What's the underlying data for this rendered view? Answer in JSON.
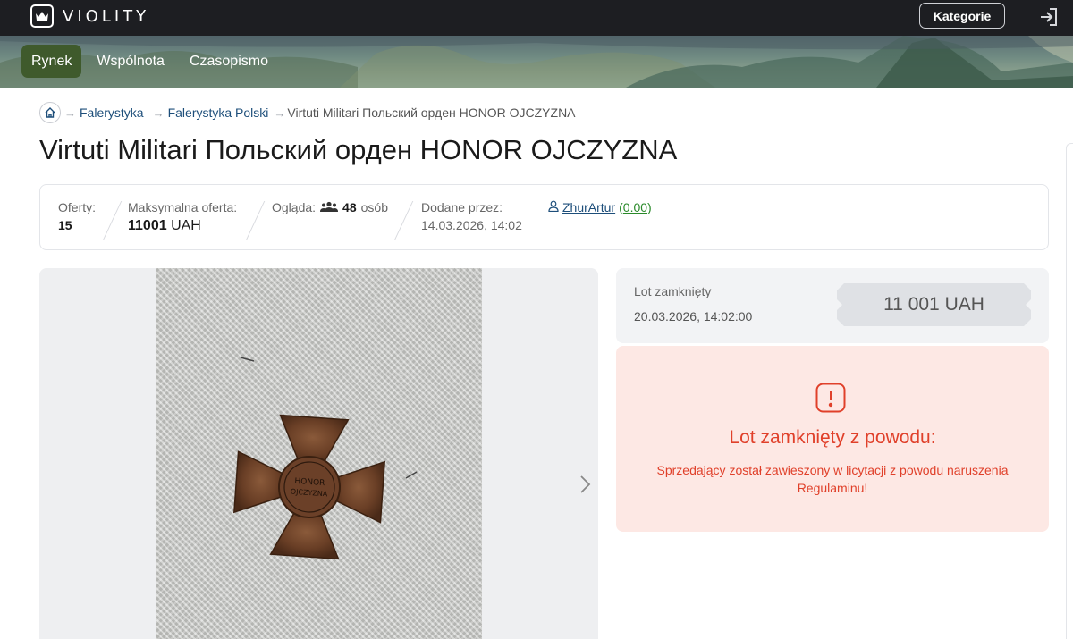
{
  "header": {
    "brand": "VIOLITY",
    "categories_label": "Kategorie"
  },
  "nav": {
    "items": [
      "Rynek",
      "Wspólnota",
      "Czasopismo"
    ],
    "active": "Rynek"
  },
  "breadcrumb": {
    "items": [
      "Falerystyka",
      "Falerystyka Polski",
      "Virtuti Militari Польский орден HONOR OJCZYZNA"
    ],
    "separator": "→"
  },
  "lot": {
    "title": "Virtuti Militari Польский орден HONOR OJCZYZNA",
    "offers_label": "Oferty:",
    "offers_value": "15",
    "max_offer_label": "Maksymalna oferta:",
    "max_offer_amount": "11001",
    "max_offer_currency": "UAH",
    "watching_label": "Ogląda:",
    "watching_count": "48",
    "watching_unit": "osób",
    "added_by_label": "Dodane przez:",
    "added_date": "14.03.2026, 14:02",
    "seller_name": "ZhurArtur",
    "seller_rating": "0.00"
  },
  "status": {
    "closed_label": "Lot zamknięty",
    "closed_date": "20.03.2026, 14:02:00",
    "final_price": "11 001 UAH"
  },
  "alert": {
    "title": "Lot zamknięty z powodu:",
    "message": "Sprzedający został zawieszony w licytacji z powodu naruszenia Regulaminu!"
  },
  "colors": {
    "topbar": "#1d1e22",
    "nav_active": "#3f5a2c",
    "link": "#1d4e7a",
    "alert_text": "#e0402a",
    "alert_bg": "#fde8e4",
    "rating": "#2a8a2a"
  }
}
